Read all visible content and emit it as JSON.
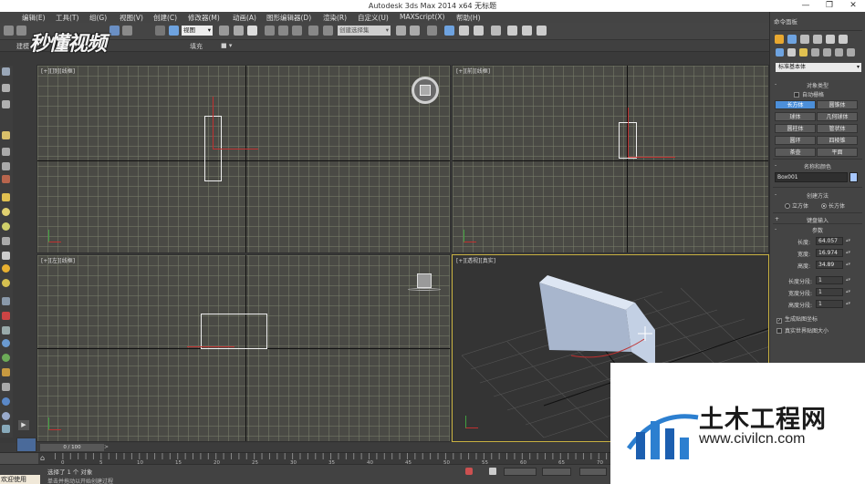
{
  "window": {
    "title": "Autodesk 3ds Max  2014 x64      无标题",
    "minimize_glyph": "—",
    "maximize_glyph": "❐",
    "close_glyph": "✕"
  },
  "menu": [
    "编辑(E)",
    "工具(T)",
    "组(G)",
    "视图(V)",
    "创建(C)",
    "修改器(M)",
    "动画(A)",
    "图形编辑器(D)",
    "渲染(R)",
    "自定义(U)",
    "MAXScript(X)",
    "帮助(H)"
  ],
  "toolbar": {
    "view_dropdown": "视图",
    "selection_set_placeholder": "创建选择集"
  },
  "ribbon": {
    "tabs": [
      "建模",
      "填充"
    ]
  },
  "viewports": {
    "top": "[+][顶][线框]",
    "front": "[+][前][线框]",
    "left": "[+][左][线框]",
    "perspective": "[+][透视][真实]"
  },
  "command_panel": {
    "title": "命令面板",
    "category_dropdown": "标准基本体",
    "object_type": {
      "header": "对象类型",
      "autogrid_label": "自动栅格",
      "buttons": [
        "长方体",
        "圆锥体",
        "球体",
        "几何球体",
        "圆柱体",
        "管状体",
        "圆环",
        "四棱锥",
        "茶壶",
        "平面"
      ]
    },
    "name_color": {
      "header": "名称和颜色",
      "name_value": "Box001",
      "swatch_color": "#a8c8ff"
    },
    "creation_method": {
      "header": "创建方法",
      "cube_label": "立方体",
      "box_label": "长方体"
    },
    "keyboard_entry": {
      "header": "键盘输入"
    },
    "parameters": {
      "header": "参数",
      "length_label": "长度:",
      "length_value": "64.057",
      "width_label": "宽度:",
      "width_value": "16.974",
      "height_label": "高度:",
      "height_value": "34.89",
      "length_segs_label": "长度分段:",
      "length_segs_value": "1",
      "width_segs_label": "宽度分段:",
      "width_segs_value": "1",
      "height_segs_label": "高度分段:",
      "height_segs_value": "1",
      "gen_mapping_label": "生成贴图坐标",
      "real_world_label": "真实世界贴图大小"
    }
  },
  "timeline": {
    "slider_label": "0 / 100",
    "ticks": [
      "0",
      "5",
      "10",
      "15",
      "20",
      "25",
      "30",
      "35",
      "40",
      "45",
      "50",
      "55",
      "60",
      "65",
      "70"
    ]
  },
  "status": {
    "welcome": "欢迎使用",
    "selected": "选择了 1 个 对象",
    "prompt": "单击并拖动以开始创建过程"
  },
  "watermarks": {
    "top_left": "秒懂视频",
    "bottom_right_cn": "土木工程网",
    "bottom_right_url": "www.civilcn.com"
  },
  "colors": {
    "selection_blue": "#4c8fd9",
    "active_viewport_border": "#c9b240",
    "gizmo_red": "#c03030",
    "box_face": "#b9c7e0"
  }
}
